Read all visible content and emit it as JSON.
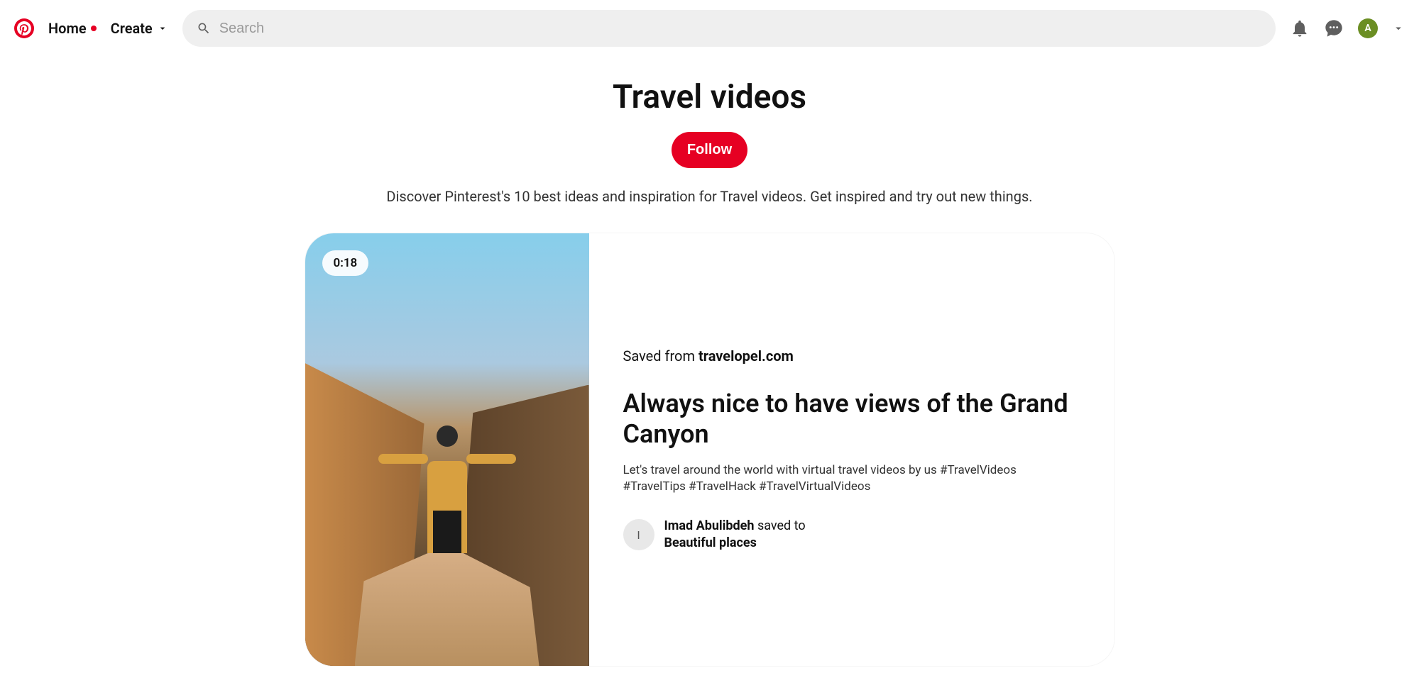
{
  "header": {
    "home_label": "Home",
    "create_label": "Create",
    "search_placeholder": "Search",
    "avatar_initial": "A"
  },
  "page": {
    "title": "Travel videos",
    "follow_label": "Follow",
    "description": "Discover Pinterest's 10 best ideas and inspiration for Travel videos. Get inspired and try out new things."
  },
  "card": {
    "duration": "0:18",
    "saved_from_prefix": "Saved from ",
    "saved_from_domain": "travelopel.com",
    "title": "Always nice to have views of the Grand Canyon",
    "description": "Let's travel around the world with virtual travel videos by us #TravelVideos #TravelTips #TravelHack #TravelVirtualVideos",
    "saver": {
      "avatar_initial": "I",
      "name": "Imad Abulibdeh",
      "saved_to_text": " saved to",
      "board": "Beautiful places"
    }
  }
}
